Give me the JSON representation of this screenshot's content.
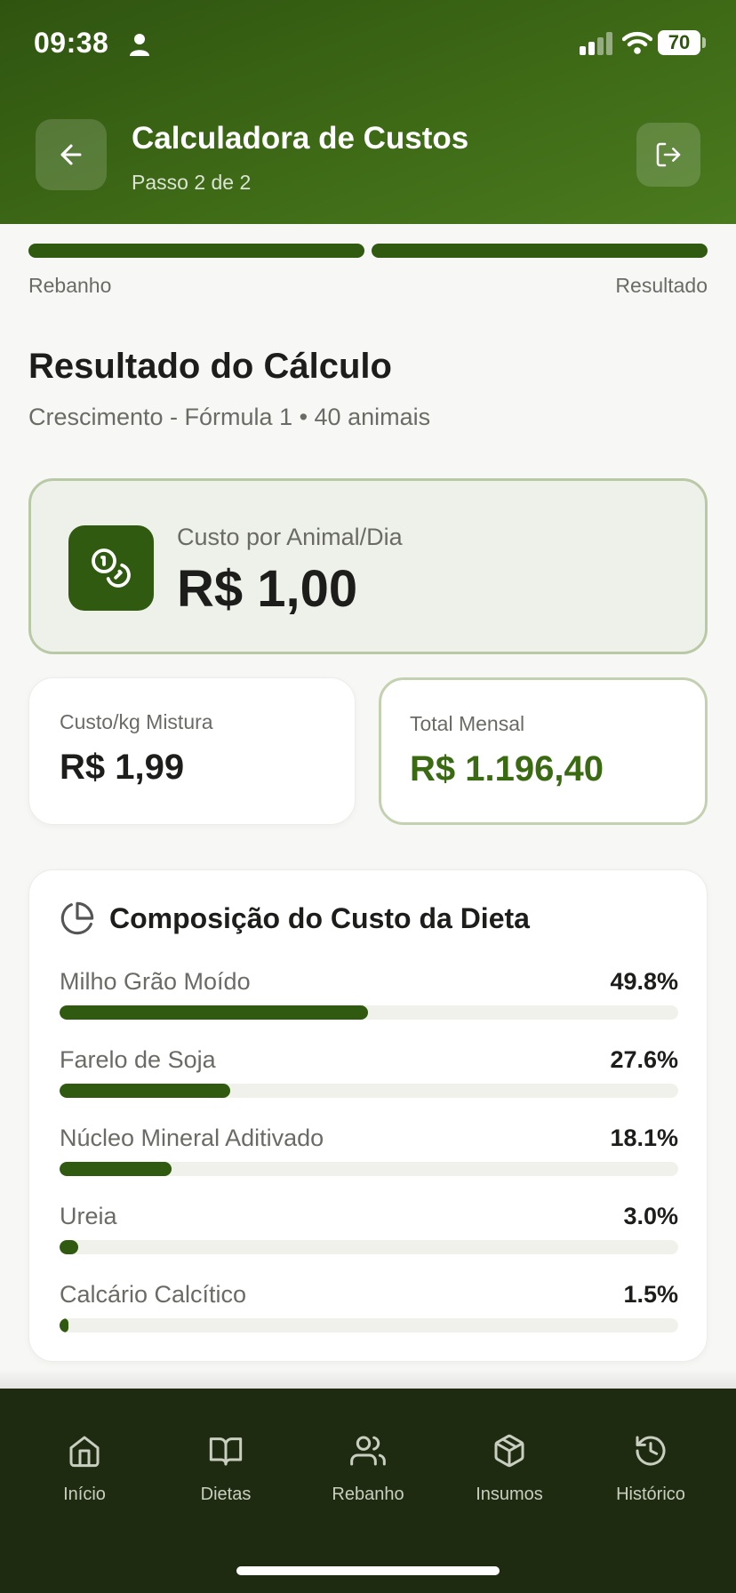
{
  "status_bar": {
    "time": "09:38",
    "battery": "70"
  },
  "header": {
    "title": "Calculadora de Custos",
    "subtitle": "Passo 2 de 2"
  },
  "steps": [
    {
      "label": "Rebanho"
    },
    {
      "label": "Resultado"
    }
  ],
  "result": {
    "title": "Resultado do Cálculo",
    "subtitle": "Crescimento - Fórmula 1 • 40 animais"
  },
  "main_cost": {
    "label": "Custo por Animal/Dia",
    "value": "R$ 1,00"
  },
  "cost_per_kg": {
    "label": "Custo/kg Mistura",
    "value": "R$ 1,99"
  },
  "monthly_total": {
    "label": "Total Mensal",
    "value": "R$ 1.196,40"
  },
  "composition": {
    "title": "Composição do Custo da Dieta",
    "items": [
      {
        "name": "Milho Grão Moído",
        "pct_label": "49.8%",
        "pct": 49.8
      },
      {
        "name": "Farelo de Soja",
        "pct_label": "27.6%",
        "pct": 27.6
      },
      {
        "name": "Núcleo Mineral Aditivado",
        "pct_label": "18.1%",
        "pct": 18.1
      },
      {
        "name": "Ureia",
        "pct_label": "3.0%",
        "pct": 3.0
      },
      {
        "name": "Calcário Calcítico",
        "pct_label": "1.5%",
        "pct": 1.5
      }
    ]
  },
  "nav": [
    {
      "label": "Início",
      "icon": "home-icon"
    },
    {
      "label": "Dietas",
      "icon": "book-icon"
    },
    {
      "label": "Rebanho",
      "icon": "users-icon"
    },
    {
      "label": "Insumos",
      "icon": "package-icon"
    },
    {
      "label": "Histórico",
      "icon": "history-icon"
    }
  ],
  "colors": {
    "brand": "#2f5a0f",
    "accent_text": "#3a6a12",
    "nav_bg": "#1f2b10"
  }
}
